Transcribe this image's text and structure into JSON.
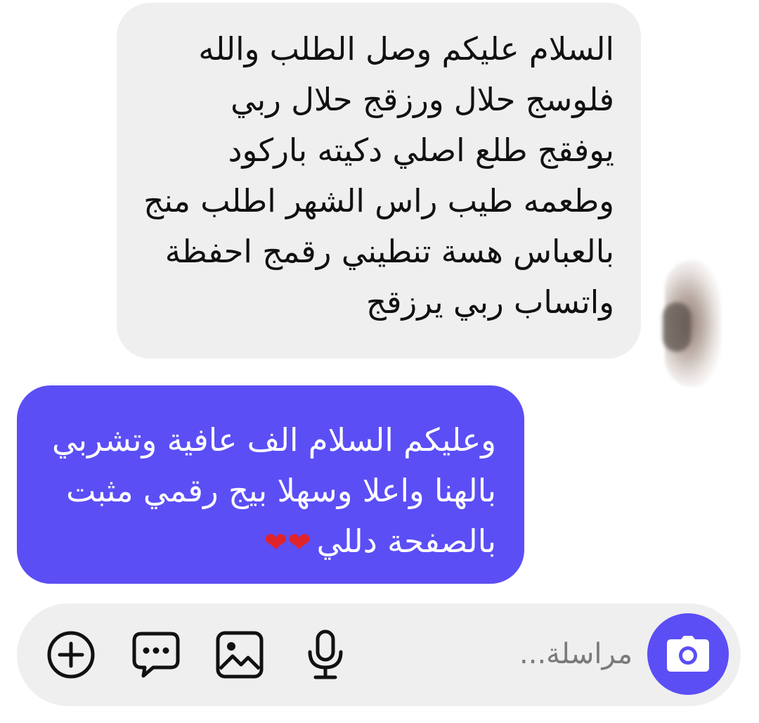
{
  "conversation": {
    "incoming_message": {
      "lines": [
        "السلام عليكم وصل الطلب والله",
        "فلوسج حلال ورزقج حلال ربي",
        "يوفقج طلع اصلي دكيته باركود",
        "وطعمه طيب راس الشهر اطلب منج",
        "بالعباس هسة تنطيني رقمج احفظة",
        "واتساب ربي يرزقج"
      ]
    },
    "outgoing_message": {
      "lines": [
        "وعليكم السلام الف عافية وتشربي",
        "بالهنا واعلا وسهلا بيج رقمي مثبت",
        "بالصفحة دللي"
      ],
      "emoji": "❤❤"
    }
  },
  "composer": {
    "placeholder": "مراسلة...",
    "icons": {
      "camera": "camera-icon",
      "mic": "microphone-icon",
      "gallery": "image-icon",
      "sticker": "chat-bubble-icon",
      "plus": "plus-circle-icon"
    }
  },
  "colors": {
    "accent": "#5b4ef5",
    "incoming_bubble": "#efefef",
    "composer_bg": "#efefef",
    "heart": "#e0242c"
  }
}
